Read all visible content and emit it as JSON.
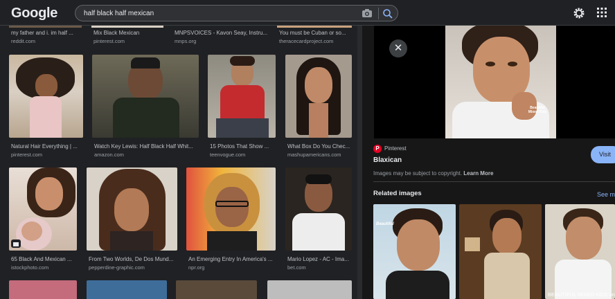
{
  "header": {
    "logo": "Google",
    "search_value": "half black half mexican",
    "icons": [
      "camera-icon",
      "search-icon",
      "gear-icon",
      "apps-grid-icon"
    ]
  },
  "results": {
    "row0": [
      {
        "caption": "my father and i. im half ...",
        "source": "reddit.com"
      },
      {
        "caption": "Mix Black Mexican",
        "source": "pinterest.com"
      },
      {
        "caption": "MNPSVOICES - Kavon Seay, Instru...",
        "source": "mnps.org"
      },
      {
        "caption": "You must be Cuban or so...",
        "source": "theracecardproject.com"
      }
    ],
    "row1": [
      {
        "caption": "Natural Hair Everything | ...",
        "source": "pinterest.com"
      },
      {
        "caption": "Watch Key Lewis: Half Black Half Whit...",
        "source": "amazon.com"
      },
      {
        "caption": "15 Photos That Show ...",
        "source": "teenvogue.com"
      },
      {
        "caption": "What Box Do You Chec...",
        "source": "mashupamericans.com"
      }
    ],
    "row2": [
      {
        "caption": "65 Black And Mexican ...",
        "source": "istockphoto.com"
      },
      {
        "caption": "From Two Worlds, De Dos Mund...",
        "source": "pepperdine-graphic.com"
      },
      {
        "caption": "An Emerging Entry In America's ...",
        "source": "npr.org"
      },
      {
        "caption": "Mario Lopez - AC - Ima...",
        "source": "bet.com"
      }
    ]
  },
  "panel": {
    "close_label": "✕",
    "site": "Pinterest",
    "title": "Blaxican",
    "visit_label": "Visit",
    "copyright_text": "Images may be subject to copyright.",
    "learn_more": "Learn More",
    "related_title": "Related images",
    "see_more": "See more",
    "hero_watermark": "Beautiful Mixed Kids",
    "related": [
      {
        "caption": "",
        "watermark": "Beautiful"
      },
      {
        "caption": "",
        "watermark": ""
      },
      {
        "caption": "BEAUTIFUL MIXED KIDS on ..."
      }
    ]
  },
  "colors": {
    "background": "#202124",
    "panel": "#171717",
    "link": "#8ab4f8",
    "pinterest": "#e60023"
  }
}
